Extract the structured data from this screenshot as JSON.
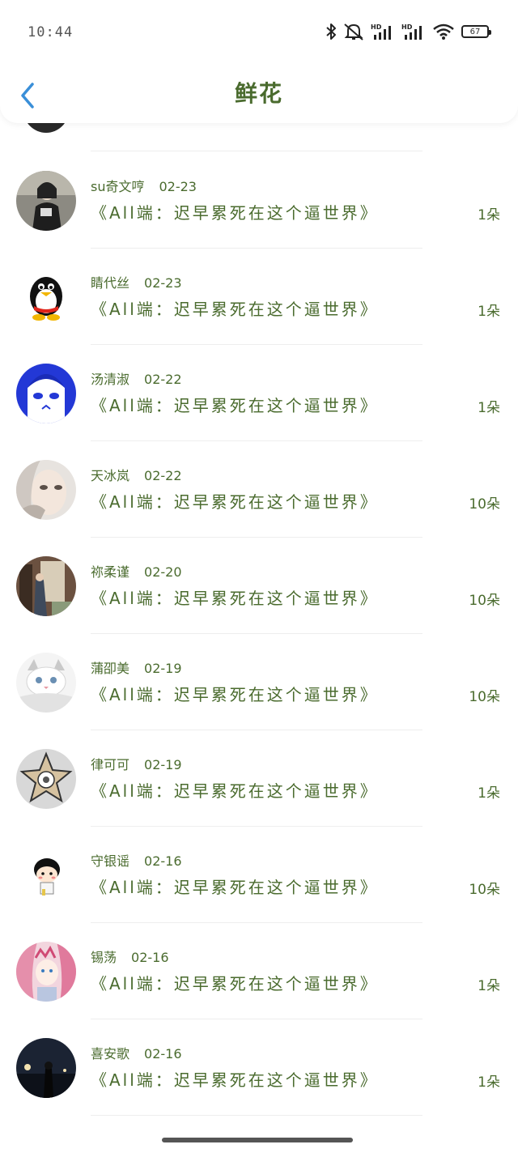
{
  "status_bar": {
    "time": "10:44",
    "battery": "67",
    "icons": [
      "bluetooth-icon",
      "muted-bell-icon",
      "hd-signal-icon",
      "hd-signal-icon",
      "wifi-icon",
      "battery-icon"
    ]
  },
  "header": {
    "title": "鲜花",
    "back_icon": "chevron-left-icon"
  },
  "gifts": [
    {
      "name": "su奇文哼",
      "date": "02-23",
      "song": "《All端：迟早累死在这个逼世界》",
      "count": "1朵"
    },
    {
      "name": "睛代丝",
      "date": "02-23",
      "song": "《All端：迟早累死在这个逼世界》",
      "count": "1朵"
    },
    {
      "name": "汤清淑",
      "date": "02-22",
      "song": "《All端：迟早累死在这个逼世界》",
      "count": "1朵"
    },
    {
      "name": "天冰岚",
      "date": "02-22",
      "song": "《All端：迟早累死在这个逼世界》",
      "count": "10朵"
    },
    {
      "name": "祢柔谨",
      "date": "02-20",
      "song": "《All端：迟早累死在这个逼世界》",
      "count": "10朵"
    },
    {
      "name": "蒲卲美",
      "date": "02-19",
      "song": "《All端：迟早累死在这个逼世界》",
      "count": "10朵"
    },
    {
      "name": "律可可",
      "date": "02-19",
      "song": "《All端：迟早累死在这个逼世界》",
      "count": "1朵"
    },
    {
      "name": "守银谣",
      "date": "02-16",
      "song": "《All端：迟早累死在这个逼世界》",
      "count": "10朵"
    },
    {
      "name": "锡荡",
      "date": "02-16",
      "song": "《All端：迟早累死在这个逼世界》",
      "count": "1朵"
    },
    {
      "name": "喜安歌",
      "date": "02-16",
      "song": "《All端：迟早累死在这个逼世界》",
      "count": "1朵"
    }
  ]
}
